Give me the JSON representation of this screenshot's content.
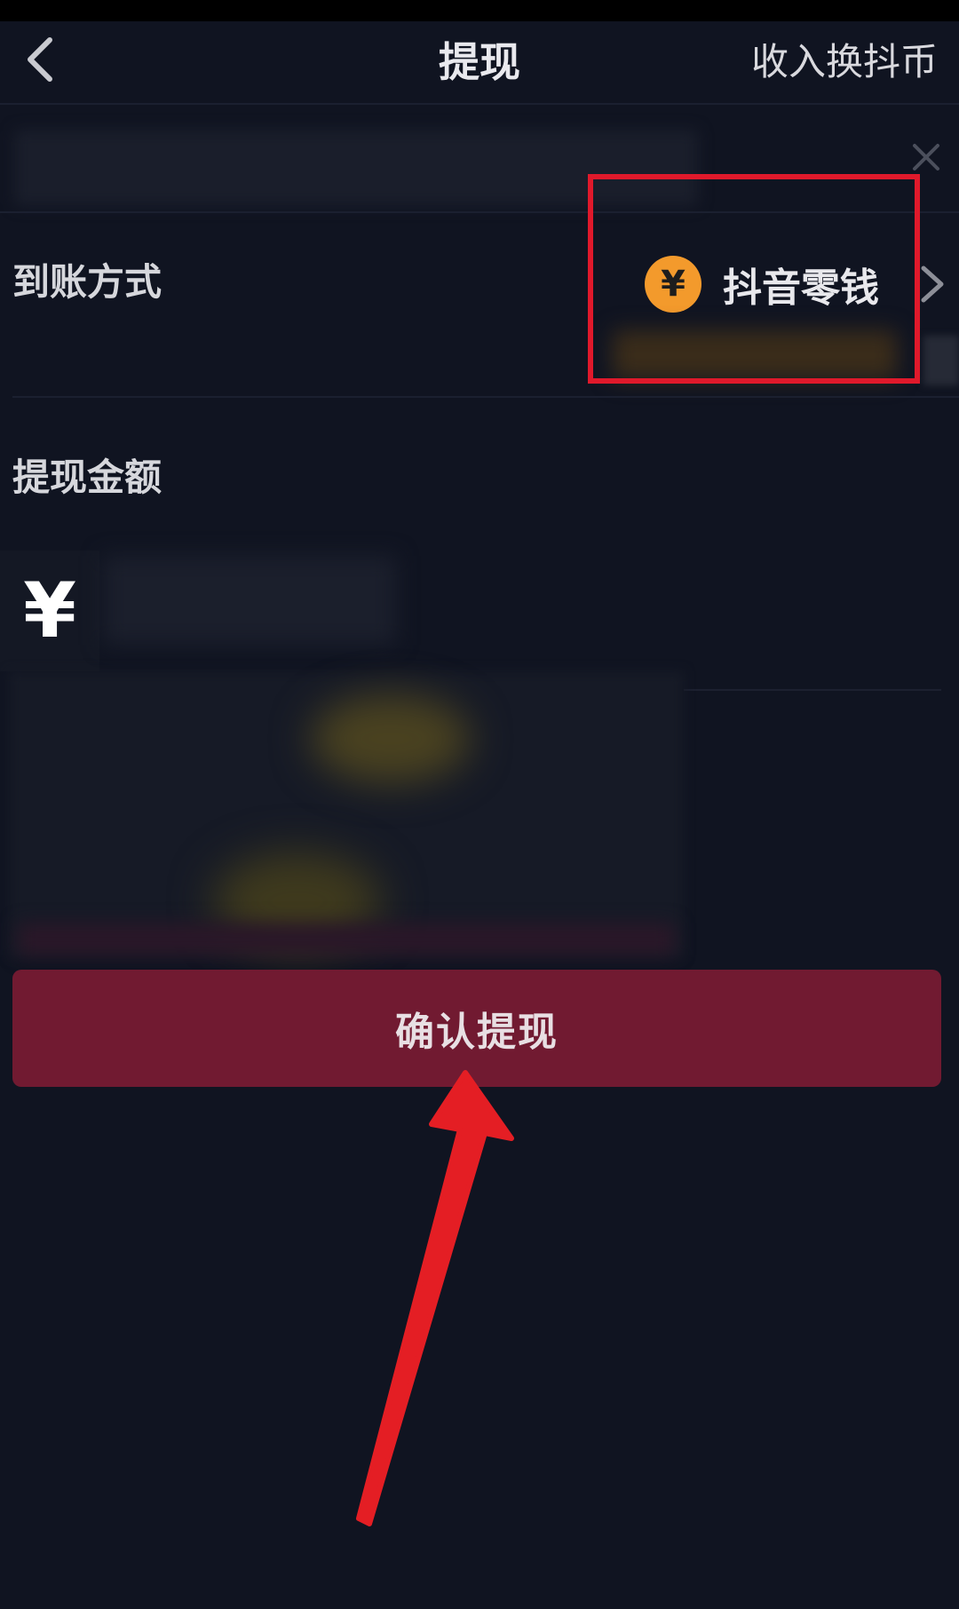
{
  "nav": {
    "title": "提现",
    "right_action": "收入换抖币"
  },
  "payout_method": {
    "label": "到账方式",
    "value": "抖音零钱",
    "icon_symbol": "¥"
  },
  "amount": {
    "label": "提现金额",
    "currency_symbol": "¥"
  },
  "confirm_button": {
    "label": "确认提现"
  },
  "colors": {
    "background": "#101421",
    "button": "#711a31",
    "coin": "#f39a2c",
    "annotation": "#e0192b"
  }
}
